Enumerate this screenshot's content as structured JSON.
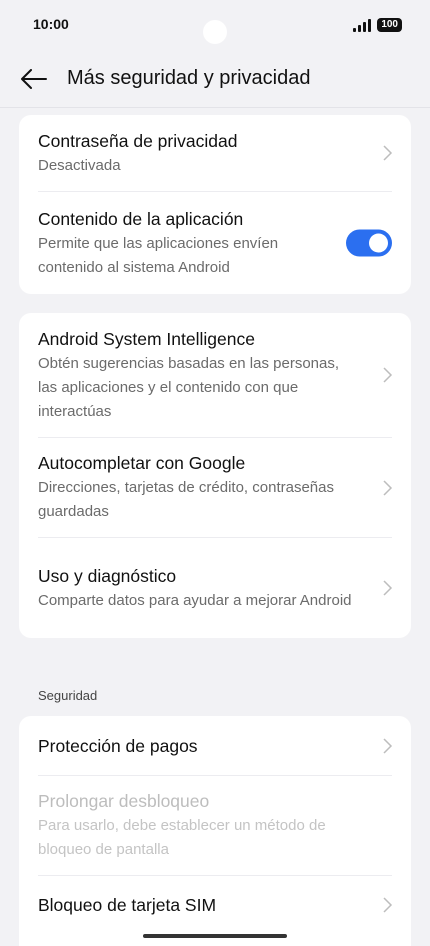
{
  "status_bar": {
    "time": "10:00",
    "battery": "100"
  },
  "header": {
    "title": "Más seguridad y privacidad"
  },
  "card1": [
    {
      "title": "Contraseña de privacidad",
      "subtitle": "Desactivada"
    },
    {
      "title": "Contenido de la aplicación",
      "subtitle": "Permite que las aplicaciones envíen contenido al sistema Android",
      "toggle_on": true
    }
  ],
  "card2": [
    {
      "title": "Android System Intelligence",
      "subtitle": "Obtén sugerencias basadas en las personas, las aplicaciones y el contenido con que interactúas"
    },
    {
      "title": "Autocompletar con Google",
      "subtitle": "Direcciones, tarjetas de crédito, contraseñas guardadas"
    },
    {
      "title": "Uso y diagnóstico",
      "subtitle": "Comparte datos para ayudar a mejorar Android"
    }
  ],
  "section_security": {
    "label": "Seguridad"
  },
  "card3": [
    {
      "title": "Protección de pagos"
    },
    {
      "title": "Prolongar desbloqueo",
      "subtitle": "Para usarlo, debe establecer un método de bloqueo de pantalla",
      "disabled": true
    },
    {
      "title": "Bloqueo de tarjeta SIM"
    }
  ],
  "colors": {
    "accent": "#2b6ff0",
    "background": "#f2f2f5",
    "card": "#ffffff"
  }
}
